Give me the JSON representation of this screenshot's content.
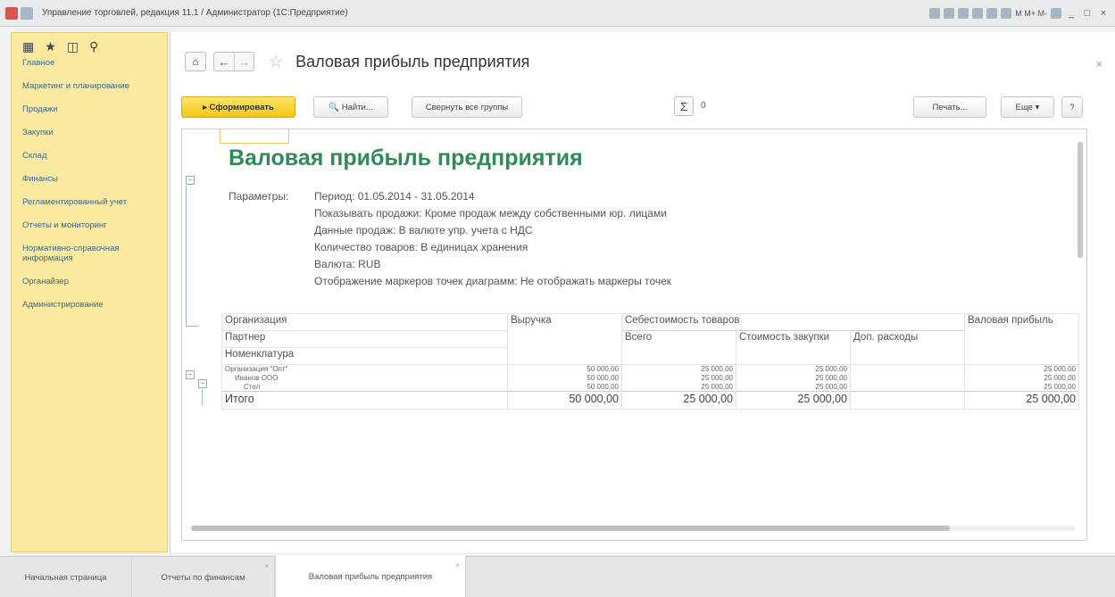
{
  "window": {
    "title": "Управление торговлей, редакция 11.1 / Администратор (1С:Предприятие)",
    "tools_text": "M  M+  M-",
    "minimize": "_",
    "maximize": "□",
    "close": "×"
  },
  "sidebar": {
    "icons": [
      "apps-grid-icon",
      "star-icon",
      "history-icon",
      "search-icon"
    ],
    "icon_glyphs": [
      "▦",
      "★",
      "◫",
      "⚲"
    ],
    "items": [
      {
        "label": "Главное"
      },
      {
        "label": "Маркетинг и планирование"
      },
      {
        "label": "Продажи"
      },
      {
        "label": "Закупки"
      },
      {
        "label": "Склад"
      },
      {
        "label": "Финансы"
      },
      {
        "label": "Регламентированный учет"
      },
      {
        "label": "Отчеты и мониторинг"
      },
      {
        "label": "Нормативно-справочная информация"
      },
      {
        "label": "Органайзер"
      },
      {
        "label": "Администрирование"
      }
    ]
  },
  "header": {
    "home_glyph": "⌂",
    "back_glyph": "←",
    "forward_glyph": "→",
    "star_glyph": "☆",
    "title": "Валовая прибыль предприятия",
    "close_glyph": "×"
  },
  "toolbar": {
    "generate_label": "▸ Сформировать",
    "find_label": "🔍 Найти...",
    "collapse_label": "Свернуть все группы",
    "sigma": "Σ",
    "sum_value": "0",
    "print_label": "Печать...",
    "more_label": "Еще  ▾",
    "help_label": "?"
  },
  "report": {
    "title": "Валовая прибыль предприятия",
    "params_label": "Параметры:",
    "params": [
      "Период: 01.05.2014 - 31.05.2014",
      "Показывать продажи: Кроме продаж между собственными юр. лицами",
      "Данные продаж: В валюте упр. учета с НДС",
      "Количество товаров: В единицах хранения",
      "Валюта: RUB",
      "Отображение маркеров точек диаграмм: Не отображать маркеры точек"
    ],
    "table": {
      "h_org": "Организация",
      "h_partner": "Партнер",
      "h_nomen": "Номенклатура",
      "h_revenue": "Выручка",
      "h_cost": "Себестоимость товаров",
      "h_total": "Всего",
      "h_purchase": "Стоимость закупки",
      "h_extra": "Доп. расходы",
      "h_gross": "Валовая прибыль",
      "rows": [
        {
          "name": "Организация \"Опт\"",
          "revenue": "50 000,00",
          "total": "25 000,00",
          "purchase": "25 000,00",
          "extra": "",
          "gross": "25 000,00"
        },
        {
          "name": "Иванов ООО",
          "revenue": "50 000,00",
          "total": "25 000,00",
          "purchase": "25 000,00",
          "extra": "",
          "gross": "25 000,00"
        },
        {
          "name": "Стол",
          "revenue": "50 000,00",
          "total": "25 000,00",
          "purchase": "25 000,00",
          "extra": "",
          "gross": "25 000,00"
        }
      ],
      "totals": {
        "label": "Итого",
        "revenue": "50 000,00",
        "total": "25 000,00",
        "purchase": "25 000,00",
        "extra": "",
        "gross": "25 000,00"
      }
    }
  },
  "tabs": [
    {
      "label": "Начальная страница"
    },
    {
      "label": "Отчеты по финансам"
    },
    {
      "label": "Валовая прибыль предприятия"
    }
  ],
  "colors": {
    "sidebar_bg": "#fbe9a0",
    "primary_button": "#f4c713",
    "report_title": "#2e8b57",
    "nav_link": "#3a6a8a"
  }
}
